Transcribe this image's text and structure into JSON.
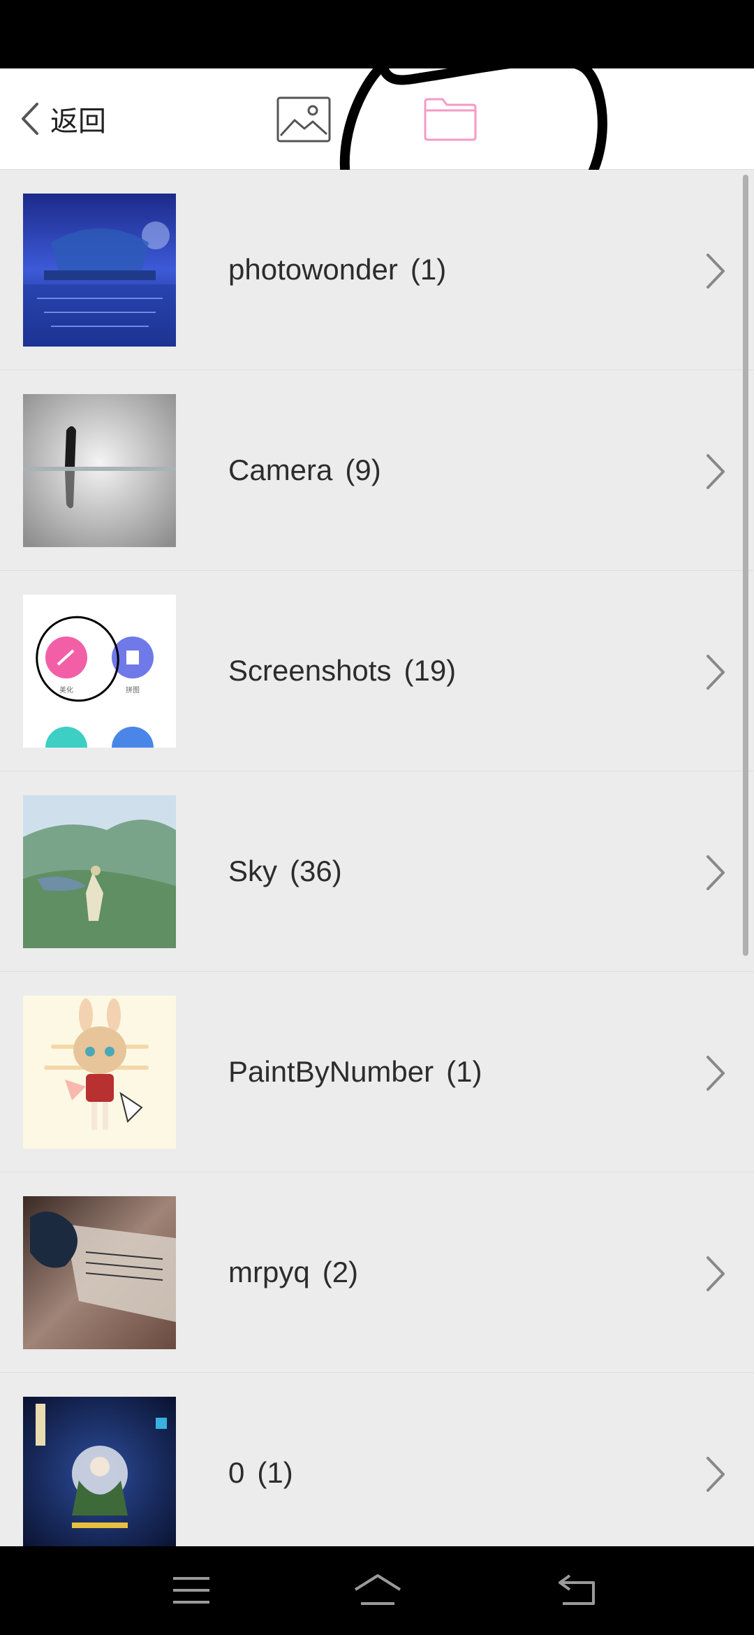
{
  "header": {
    "back_label": "返回",
    "tabs": [
      {
        "name": "photos",
        "icon": "image-icon",
        "active": false
      },
      {
        "name": "albums",
        "icon": "folder-icon",
        "active": true
      }
    ],
    "active_color": "#f59ac6"
  },
  "albums": [
    {
      "name": "photowonder",
      "count": "(1)",
      "thumb": "night-boat-thumbnail"
    },
    {
      "name": "Camera",
      "count": "(9)",
      "thumb": "silhouette-reflection-thumbnail"
    },
    {
      "name": "Screenshots",
      "count": "(19)",
      "thumb": "app-icons-screenshot-thumbnail"
    },
    {
      "name": "Sky",
      "count": "(36)",
      "thumb": "game-landscape-thumbnail"
    },
    {
      "name": "PaintByNumber",
      "count": "(1)",
      "thumb": "anime-girl-thumbnail"
    },
    {
      "name": "mrpyq",
      "count": "(2)",
      "thumb": "notebook-photo-thumbnail"
    },
    {
      "name": "0",
      "count": "(1)",
      "thumb": "blue-art-thumbnail"
    }
  ],
  "nav": {
    "items": [
      {
        "icon": "menu-icon"
      },
      {
        "icon": "home-icon"
      },
      {
        "icon": "back-icon"
      }
    ]
  }
}
